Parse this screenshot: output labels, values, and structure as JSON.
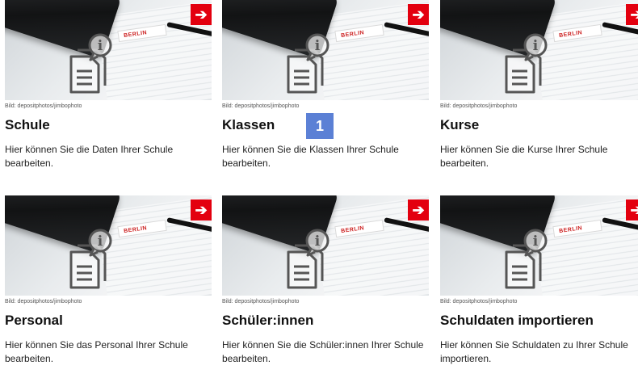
{
  "cards": [
    {
      "credit": "Bild: depositphotos/jimbophoto",
      "title": "Schule",
      "desc": "Hier können Sie die Daten Ihrer Schule bearbeiten."
    },
    {
      "credit": "Bild: depositphotos/jimbophoto",
      "title": "Klassen",
      "desc": "Hier können Sie die Klassen Ihrer Schule bearbeiten."
    },
    {
      "credit": "Bild: depositphotos/jimbophoto",
      "title": "Kurse",
      "desc": "Hier können Sie die Kurse Ihrer Schule bearbeiten."
    },
    {
      "credit": "Bild: depositphotos/jimbophoto",
      "title": "Personal",
      "desc": "Hier können Sie das Personal Ihrer Schule bearbeiten."
    },
    {
      "credit": "Bild: depositphotos/jimbophoto",
      "title": "Schüler:innen",
      "desc": "Hier können Sie die Schüler:innen Ihrer Schule bearbeiten."
    },
    {
      "credit": "Bild: depositphotos/jimbophoto",
      "title": "Schuldaten importieren",
      "desc": "Hier können Sie Schuldaten zu Ihrer Schule importieren."
    }
  ],
  "image": {
    "tag_text": "BERLIN",
    "arrow_glyph": "➔"
  },
  "marker": {
    "label": "1"
  },
  "colors": {
    "accent": "#e3000f",
    "marker": "#4a73d1"
  }
}
